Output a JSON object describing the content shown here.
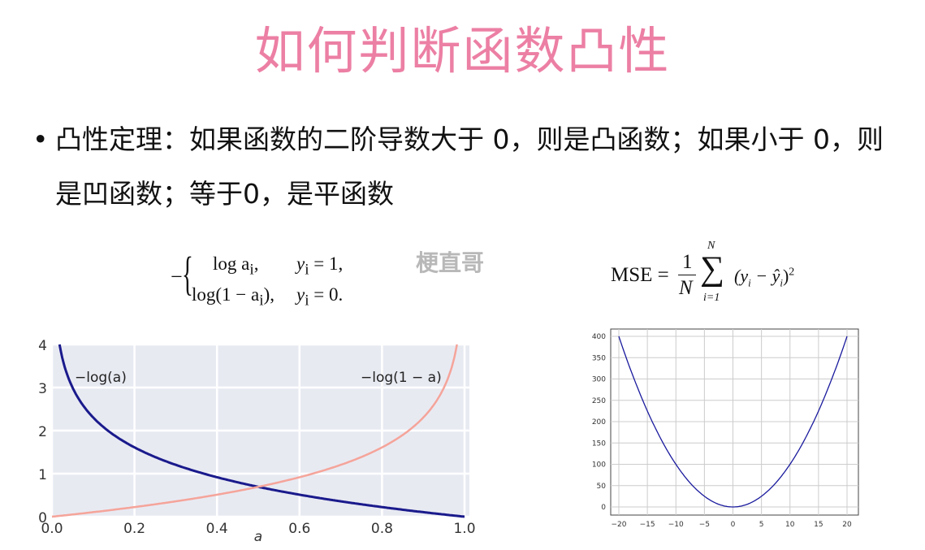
{
  "slide": {
    "title": "如何判断函数凸性",
    "bullet_symbol": "•",
    "bullet_text": "凸性定理：如果函数的二阶导数大于 0，则是凸函数；如果小于 0，则是凹函数；等于0，是平函数",
    "watermark": "梗直哥",
    "cross_entropy_formula": {
      "prefix": "−",
      "row1_expr": "log a",
      "row1_sub": "i",
      "row1_cond": "y",
      "row1_cond_rest": " = 1,",
      "row2_expr": "log(1 − a",
      "row2_close": "),",
      "row2_cond_rest": " = 0."
    },
    "mse_formula": {
      "lhs": "MSE = ",
      "num": "1",
      "den": "N",
      "sum_top": "N",
      "sum_bottom": "i=1",
      "body": "(y",
      "body2": " − ŷ",
      "body3": ")",
      "power": "2"
    }
  },
  "colors": {
    "title": "#ec7fa4",
    "blue": "#1a1a8c",
    "salmon": "#f5a49a",
    "plotbg": "#e8eaf2"
  },
  "chart_data": [
    {
      "type": "line",
      "title": "",
      "xlabel": "a",
      "ylabel": "",
      "xlim": [
        0,
        1
      ],
      "ylim": [
        0,
        4
      ],
      "xticks": [
        "0.0",
        "0.2",
        "0.4",
        "0.6",
        "0.8",
        "1.0"
      ],
      "yticks": [
        "0",
        "1",
        "2",
        "3",
        "4"
      ],
      "grid": true,
      "series": [
        {
          "name": "−log(a)",
          "function": "-ln(a)",
          "color": "#1a1a8c",
          "x": [
            0.018,
            0.05,
            0.1,
            0.2,
            0.3,
            0.4,
            0.5,
            0.6,
            0.7,
            0.8,
            0.9,
            1.0
          ],
          "y": [
            4.0,
            3.0,
            2.3,
            1.61,
            1.2,
            0.92,
            0.69,
            0.51,
            0.36,
            0.22,
            0.11,
            0
          ]
        },
        {
          "name": "−log(1 − a)",
          "function": "-ln(1-a)",
          "color": "#f5a49a",
          "x": [
            0,
            0.1,
            0.2,
            0.3,
            0.4,
            0.5,
            0.6,
            0.7,
            0.8,
            0.9,
            0.95,
            0.982
          ],
          "y": [
            0,
            0.11,
            0.22,
            0.36,
            0.51,
            0.69,
            0.92,
            1.2,
            1.61,
            2.3,
            3.0,
            4.0
          ]
        }
      ],
      "annotations": [
        "−log(a)",
        "−log(1 − a)"
      ]
    },
    {
      "type": "line",
      "title": "",
      "xlabel": "",
      "ylabel": "",
      "xlim": [
        -22,
        22
      ],
      "ylim": [
        -20,
        420
      ],
      "xticks": [
        "−20",
        "−15",
        "−10",
        "−5",
        "0",
        "5",
        "10",
        "15",
        "20"
      ],
      "yticks": [
        "0",
        "50",
        "100",
        "150",
        "200",
        "250",
        "300",
        "350",
        "400"
      ],
      "grid": true,
      "series": [
        {
          "name": "x^2",
          "function": "x^2",
          "color": "#1a1a9e",
          "x": [
            -20,
            -15,
            -10,
            -5,
            0,
            5,
            10,
            15,
            20
          ],
          "y": [
            400,
            225,
            100,
            25,
            0,
            25,
            100,
            225,
            400
          ]
        }
      ]
    }
  ]
}
